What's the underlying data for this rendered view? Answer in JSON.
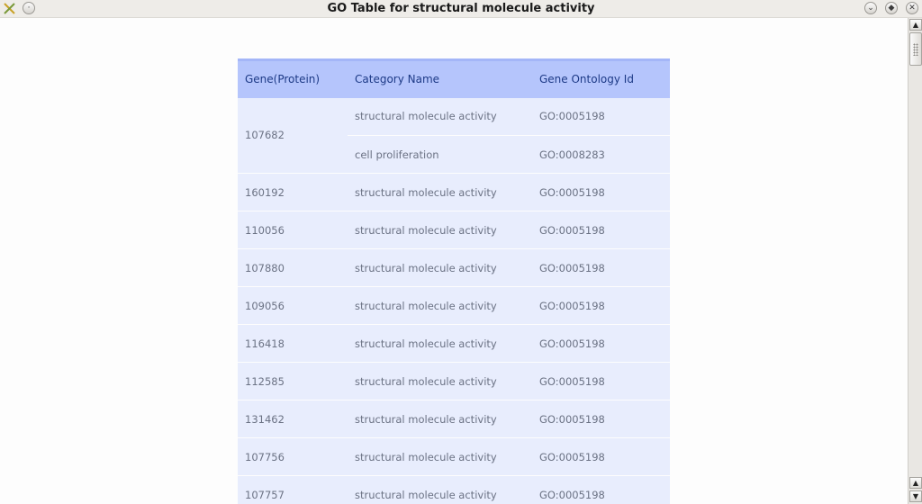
{
  "window": {
    "title": "GO Table for structural molecule activity",
    "controls": {
      "menu_icon": "circle-icon",
      "shade_icon": "chevron-down-icon",
      "maximize_icon": "diamond-icon",
      "close_icon": "close-icon"
    }
  },
  "table": {
    "headers": {
      "gene": "Gene(Protein)",
      "category": "Category Name",
      "go_id": "Gene Ontology Id"
    },
    "rows": [
      {
        "gene": "107682",
        "entries": [
          {
            "category": "structural molecule activity",
            "go_id": "GO:0005198"
          },
          {
            "category": "cell proliferation",
            "go_id": "GO:0008283"
          }
        ]
      },
      {
        "gene": "160192",
        "entries": [
          {
            "category": "structural molecule activity",
            "go_id": "GO:0005198"
          }
        ]
      },
      {
        "gene": "110056",
        "entries": [
          {
            "category": "structural molecule activity",
            "go_id": "GO:0005198"
          }
        ]
      },
      {
        "gene": "107880",
        "entries": [
          {
            "category": "structural molecule activity",
            "go_id": "GO:0005198"
          }
        ]
      },
      {
        "gene": "109056",
        "entries": [
          {
            "category": "structural molecule activity",
            "go_id": "GO:0005198"
          }
        ]
      },
      {
        "gene": "116418",
        "entries": [
          {
            "category": "structural molecule activity",
            "go_id": "GO:0005198"
          }
        ]
      },
      {
        "gene": "112585",
        "entries": [
          {
            "category": "structural molecule activity",
            "go_id": "GO:0005198"
          }
        ]
      },
      {
        "gene": "131462",
        "entries": [
          {
            "category": "structural molecule activity",
            "go_id": "GO:0005198"
          }
        ]
      },
      {
        "gene": "107756",
        "entries": [
          {
            "category": "structural molecule activity",
            "go_id": "GO:0005198"
          }
        ]
      },
      {
        "gene": "107757",
        "entries": [
          {
            "category": "structural molecule activity",
            "go_id": "GO:0005198"
          }
        ]
      }
    ]
  },
  "colors": {
    "header_bg": "#b5c5fc",
    "header_text": "#1d3a86",
    "row_bg": "#e8edfd",
    "cell_text": "#6b7284"
  }
}
